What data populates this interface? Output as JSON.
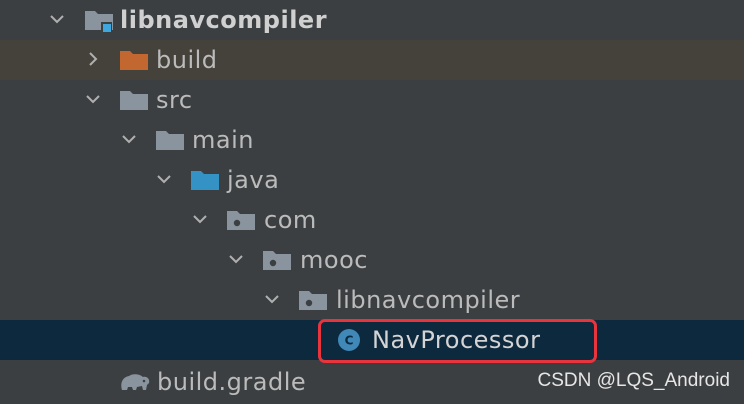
{
  "tree": {
    "root": {
      "label": "libnavcompiler",
      "expanded": true,
      "icon": "module-folder-icon"
    },
    "build": {
      "label": "build",
      "expanded": false,
      "icon": "excluded-folder-icon"
    },
    "src": {
      "label": "src",
      "expanded": true,
      "icon": "folder-icon"
    },
    "main": {
      "label": "main",
      "expanded": true,
      "icon": "folder-icon"
    },
    "java": {
      "label": "java",
      "expanded": true,
      "icon": "source-root-folder-icon"
    },
    "com": {
      "label": "com",
      "expanded": true,
      "icon": "package-icon"
    },
    "mooc": {
      "label": "mooc",
      "expanded": true,
      "icon": "package-icon"
    },
    "libnavcompiler_pkg": {
      "label": "libnavcompiler",
      "expanded": true,
      "icon": "package-icon"
    },
    "navprocessor": {
      "label": "NavProcessor",
      "icon": "java-class-icon",
      "class_badge": "C",
      "selected": true
    },
    "build_gradle": {
      "label": "build.gradle",
      "icon": "gradle-elephant-icon"
    }
  },
  "colors": {
    "background": "#3c3f41",
    "text": "#bbbbbb",
    "selected_row": "#0d293e",
    "highlight_row": "#45413b",
    "folder": "#8a949e",
    "excluded_folder": "#c1672f",
    "source_folder": "#3592c4",
    "highlight_box": "#e8343c"
  },
  "watermark": "CSDN @LQS_Android"
}
